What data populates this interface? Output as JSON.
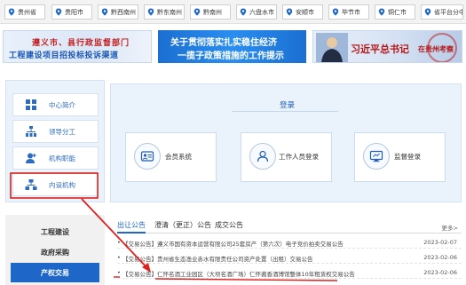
{
  "regions": [
    "贵州省",
    "贵阳市",
    "黔西南州",
    "黔东南州",
    "黔南州",
    "六盘水市",
    "安顺市",
    "毕节市",
    "铜仁市",
    "省平台分中心"
  ],
  "banners": {
    "left_line1": "遵义市、县行政监督部门",
    "left_line2": "工程建设项目招投标投诉渠道",
    "middle_line1": "关于贯彻落实扎实稳住经济",
    "middle_line2": "一揽子政策措施的工作提示",
    "right_title": "习近平总书记",
    "right_sub": "在贵州考察"
  },
  "side_menu": [
    "中心简介",
    "领导分工",
    "机构职能",
    "内设机构"
  ],
  "login": {
    "title": "登录",
    "options": [
      "会员系统",
      "工作人员登录",
      "监督登录"
    ]
  },
  "sections": [
    "工程建设",
    "政府采购",
    "产权交易"
  ],
  "announcements": {
    "tabs": [
      "出让公告",
      "澄清（更正）公告",
      "成交公告"
    ],
    "more": "更多>",
    "items": [
      {
        "bullet": "•",
        "title": "【交易公告】遵义市国有资本运营有限公司25套房产（第六次）电子竞价拍卖交易公告",
        "date": "2023-02-07"
      },
      {
        "bullet": "•",
        "title": "【交易公告】贵州省生态渔业赤水有限责任公司资产处置（出租）交易公告",
        "date": "2023-02-06"
      },
      {
        "bullet": "•",
        "title": "【交易公告】仁怀名酒工业园区（大坝名酒广场）仁怀酱香酒博馆整体10年租赁权交易公告",
        "date": "2023-02-06"
      }
    ]
  },
  "colors": {
    "accent": "#1e66c8",
    "annotation": "#e0201c"
  }
}
